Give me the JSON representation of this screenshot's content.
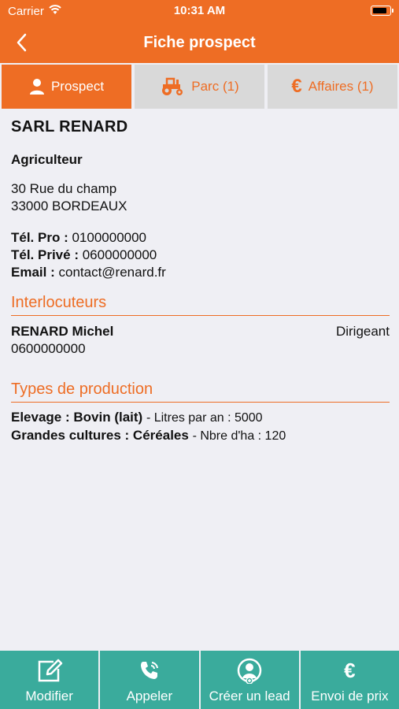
{
  "status": {
    "carrier": "Carrier",
    "time": "10:31 AM"
  },
  "nav": {
    "title": "Fiche prospect"
  },
  "tabs": [
    {
      "label": "Prospect",
      "icon": "person-icon"
    },
    {
      "label": "Parc (1)",
      "icon": "tractor-icon"
    },
    {
      "label": "Affaires (1)",
      "icon": "euro-icon"
    }
  ],
  "prospect": {
    "company": "SARL RENARD",
    "activity": "Agriculteur",
    "address_line1": "30 Rue du champ",
    "address_line2": "33000 BORDEAUX",
    "tel_pro_label": "Tél. Pro :",
    "tel_pro": "0100000000",
    "tel_prive_label": "Tél. Privé :",
    "tel_prive": "0600000000",
    "email_label": "Email :",
    "email": "contact@renard.fr"
  },
  "interlocuteurs": {
    "title": "Interlocuteurs",
    "items": [
      {
        "name": "RENARD Michel",
        "role": "Dirigeant",
        "phone": "0600000000"
      }
    ]
  },
  "production": {
    "title": "Types de production",
    "items": [
      {
        "type": "Elevage : Bovin (lait)",
        "detail": "- Litres par an : 5000"
      },
      {
        "type": "Grandes cultures : Céréales",
        "detail": "- Nbre d'ha : 120"
      }
    ]
  },
  "actions": [
    {
      "label": "Modifier",
      "icon": "edit-icon"
    },
    {
      "label": "Appeler",
      "icon": "phone-icon"
    },
    {
      "label": "Créer un lead",
      "icon": "create-lead-icon"
    },
    {
      "label": "Envoi de prix",
      "icon": "euro-icon"
    }
  ],
  "colors": {
    "primary": "#ee6d24",
    "action": "#3aab9c",
    "background": "#efeff4",
    "tab_inactive": "#d9d9d9"
  }
}
